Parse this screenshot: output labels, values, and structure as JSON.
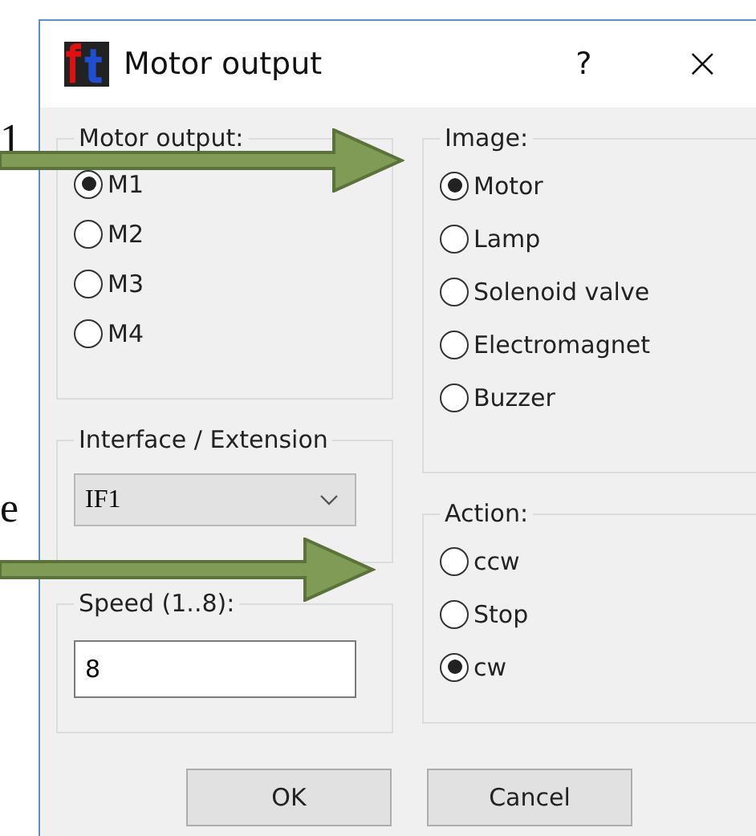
{
  "page_text": [
    "1",
    "e"
  ],
  "window": {
    "title": "Motor output",
    "help": "?",
    "close": "×"
  },
  "motor_output": {
    "label": "Motor output:",
    "options": [
      {
        "label": "M1",
        "selected": true
      },
      {
        "label": "M2",
        "selected": false
      },
      {
        "label": "M3",
        "selected": false
      },
      {
        "label": "M4",
        "selected": false
      }
    ]
  },
  "interface": {
    "label": "Interface / Extension",
    "value": "IF1"
  },
  "speed": {
    "label": "Speed (1..8):",
    "value": "8"
  },
  "image": {
    "label": "Image:",
    "options": [
      {
        "label": "Motor",
        "selected": true
      },
      {
        "label": "Lamp",
        "selected": false
      },
      {
        "label": "Solenoid valve",
        "selected": false
      },
      {
        "label": "Electromagnet",
        "selected": false
      },
      {
        "label": "Buzzer",
        "selected": false
      }
    ]
  },
  "action": {
    "label": "Action:",
    "options": [
      {
        "label": "ccw",
        "selected": false
      },
      {
        "label": "Stop",
        "selected": false
      },
      {
        "label": "cw",
        "selected": true
      }
    ]
  },
  "buttons": [
    "OK",
    "Cancel"
  ]
}
